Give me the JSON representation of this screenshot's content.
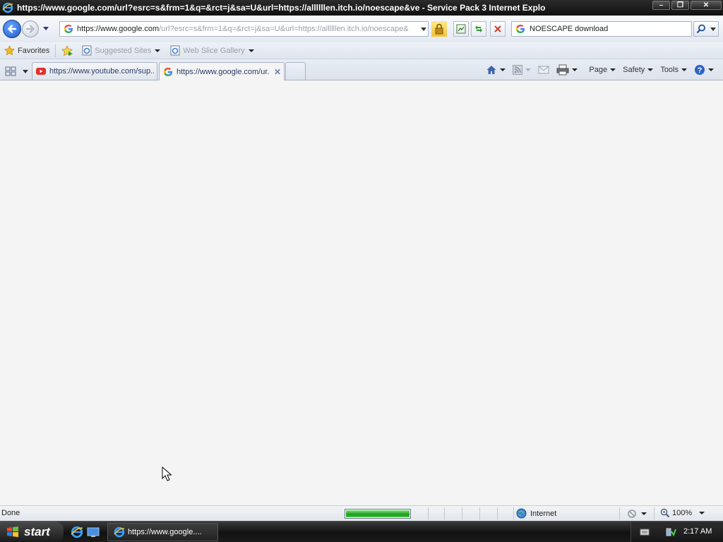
{
  "window": {
    "title": "https://www.google.com/url?esrc=s&frm=1&q=&rct=j&sa=U&url=https://allllllen.itch.io/noescape&ve - Service Pack 3 Internet Explo",
    "buttons": {
      "minimize": "–",
      "maximize": "❐",
      "close": "✕"
    }
  },
  "address_bar": {
    "url_prefix": "https://www.",
    "url_host": "google.com",
    "url_rest": "/url?esrc=s&frm=1&q=&rct=j&sa=U&url=https://allllllen.itch.io/noescape&"
  },
  "search_box": {
    "value": "NOESCAPE download"
  },
  "favorites_bar": {
    "favorites_label": "Favorites",
    "items": [
      {
        "label": "Suggested Sites"
      },
      {
        "label": "Web Slice Gallery"
      }
    ]
  },
  "tabs": [
    {
      "label": "https://www.youtube.com/sup...",
      "active": false,
      "favicon": "youtube-icon"
    },
    {
      "label": "https://www.google.com/ur...",
      "active": true,
      "favicon": "google-icon"
    }
  ],
  "command_bar": {
    "page": "Page",
    "safety": "Safety",
    "tools": "Tools"
  },
  "status_bar": {
    "status": "Done",
    "progress": 1.0,
    "zone": "Internet",
    "zoom": "100%"
  },
  "taskbar": {
    "start_label": "start",
    "window_button": "https://www.google....",
    "clock": "2:17 AM"
  },
  "colors": {
    "accent": "#1c58c9",
    "progress_green": "#1a9a1a",
    "content_bg": "#f4f4f4"
  }
}
